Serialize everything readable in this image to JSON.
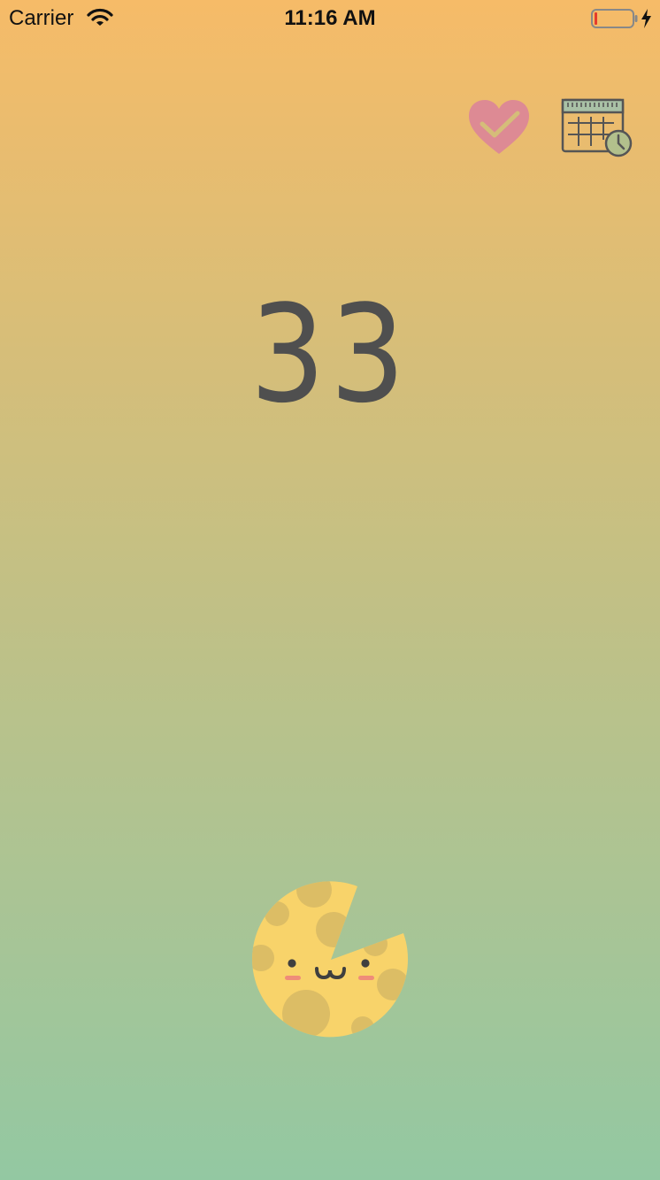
{
  "status_bar": {
    "carrier": "Carrier",
    "time": "11:16 AM",
    "wifi_icon": "wifi-icon",
    "battery_icon": "battery-low-charging-icon"
  },
  "actions": {
    "heart_icon": "heart-check-icon",
    "calendar_icon": "calendar-clock-icon"
  },
  "counter": {
    "value": "33"
  },
  "mascot": {
    "icon": "cheese-face-icon"
  },
  "colors": {
    "gradient_top": "#f6bb68",
    "gradient_bottom": "#93c8a2",
    "counter_text": "#4f4f4f",
    "heart": "#dd8a94",
    "icon_stroke": "#555555",
    "cheese": "#f8d36a",
    "cheese_holes": "#dcbd65",
    "battery_low": "#e53b2c"
  }
}
